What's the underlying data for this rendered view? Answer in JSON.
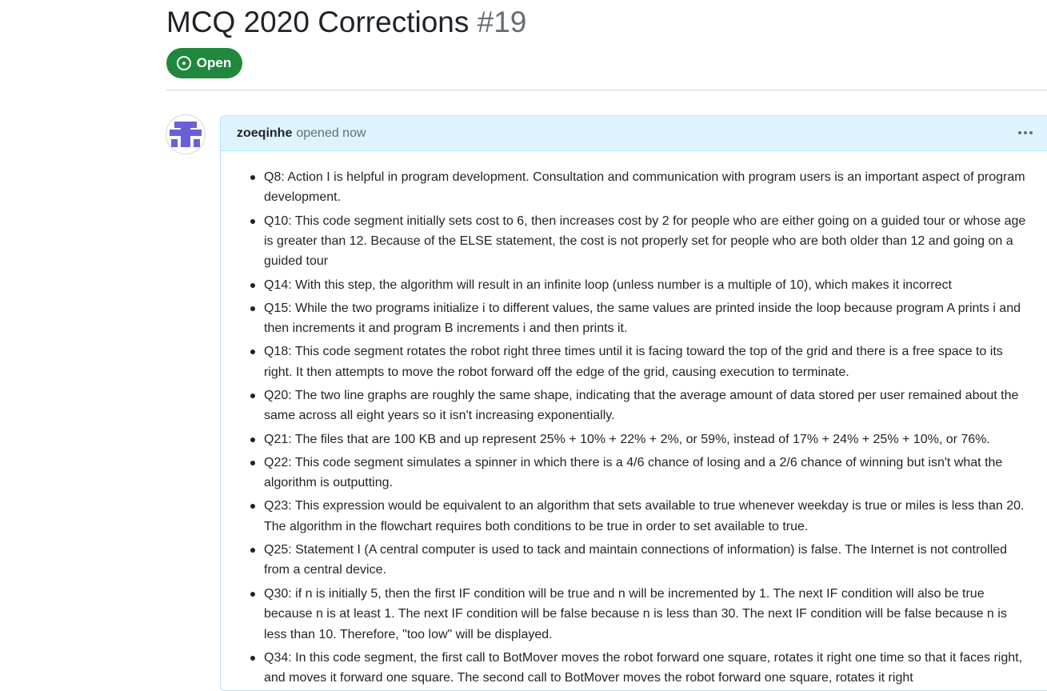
{
  "issue": {
    "title": "MCQ 2020 Corrections",
    "number": "#19",
    "state": "Open",
    "state_color": "#1f883d"
  },
  "comment": {
    "author": "zoeqinhe",
    "action": "opened now",
    "menu_icon": "kebab-horizontal-icon",
    "items": [
      "Q8: Action I is helpful in program development. Consultation and communication with program users is an important aspect of program development.",
      "Q10: This code segment initially sets  cost  to  6, then increases  cost  by  2  for people who are either going on a guided tour or whose age is greater than 12. Because of the  ELSE  statement, the cost is not properly set for people who are both older than 12 and going on a guided tour",
      "Q14: With this step, the algorithm will result in an infinite loop (unless  number  is a multiple of  10), which makes it incorrect",
      "Q15: While the two programs initialize  i  to different values, the same values are printed inside the loop because program A prints  i  and then increments it and program B increments  i  and then prints it.",
      "Q18: This code segment rotates the robot right three times until it is facing toward the top of the grid and there is a free space to its right. It then attempts to move the robot forward off the edge of the grid, causing execution to terminate.",
      "Q20: The two line graphs are roughly the same shape, indicating that the average amount of data stored per user remained about the same across all eight years so it isn't increasing exponentially.",
      "Q21: The files that are 100 KB and up represent 25% + 10% + 22% + 2%, or 59%, instead of 17% + 24% + 25% + 10%, or 76%.",
      "Q22: This code segment simulates a spinner in which there is a 4/6 chance of losing and a 2/6 chance of winning but isn't what the algorithm is outputting.",
      "Q23: This expression would be equivalent to an algorithm that sets  available  to  true  whenever  weekday  is  true  or  miles  is less than  20. The algorithm in the flowchart requires both conditions to be  true  in order to set  available  to  true.",
      "Q25: Statement I (A central computer is used to tack and maintain connections of information) is false. The Internet is not controlled from a central device.",
      "Q30: if  n  is initially  5, then the first  IF  condition will be  true  and  n  will be incremented by  1. The next  IF  condition will also be  true  because  n  is at least  1. The next  IF  condition will be  false  because  n  is less than  30. The next  IF  condition will be  false  because  n  is less than  10. Therefore,  \"too low\"  will be displayed.",
      "Q34: In this code segment, the first call to  BotMover  moves the robot forward one square, rotates it right one time so that it faces right, and moves it forward one square. The second call to  BotMover  moves the robot forward one square, rotates it right"
    ]
  }
}
